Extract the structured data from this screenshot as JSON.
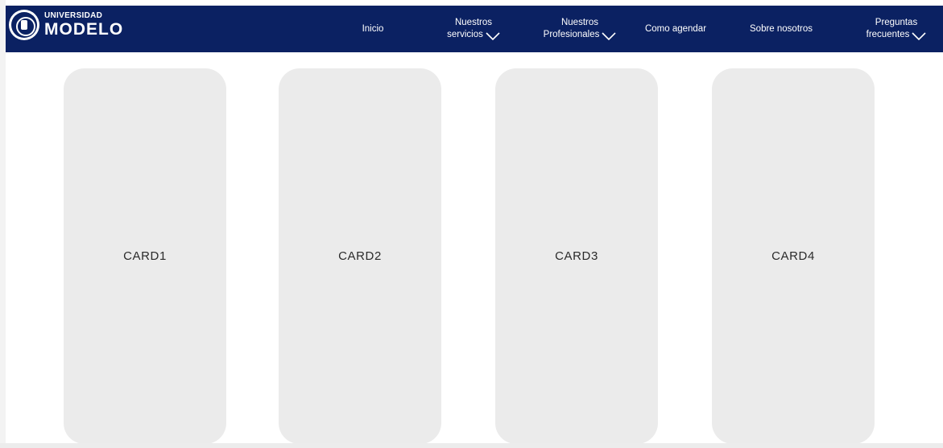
{
  "brand": {
    "line1": "UNIVERSIDAD",
    "line2": "MODELO",
    "seal_icon": "university-seal-icon"
  },
  "nav": {
    "inicio": "Inicio",
    "servicios_line1": "Nuestros",
    "servicios_line2": "servicios",
    "profesionales_line1": "Nuestros",
    "profesionales_line2": "Profesionales",
    "como_agendar": "Como agendar",
    "sobre_nosotros": "Sobre nosotros",
    "preguntas_line1": "Preguntas",
    "preguntas_line2": "frecuentes",
    "dropdown_icon": "chevron-down-icon"
  },
  "cards": [
    "CARD1",
    "CARD2",
    "CARD3",
    "CARD4"
  ],
  "colors": {
    "navbar": "#0b2162",
    "card": "#ebebeb",
    "text_on_nav": "#ffffff"
  }
}
